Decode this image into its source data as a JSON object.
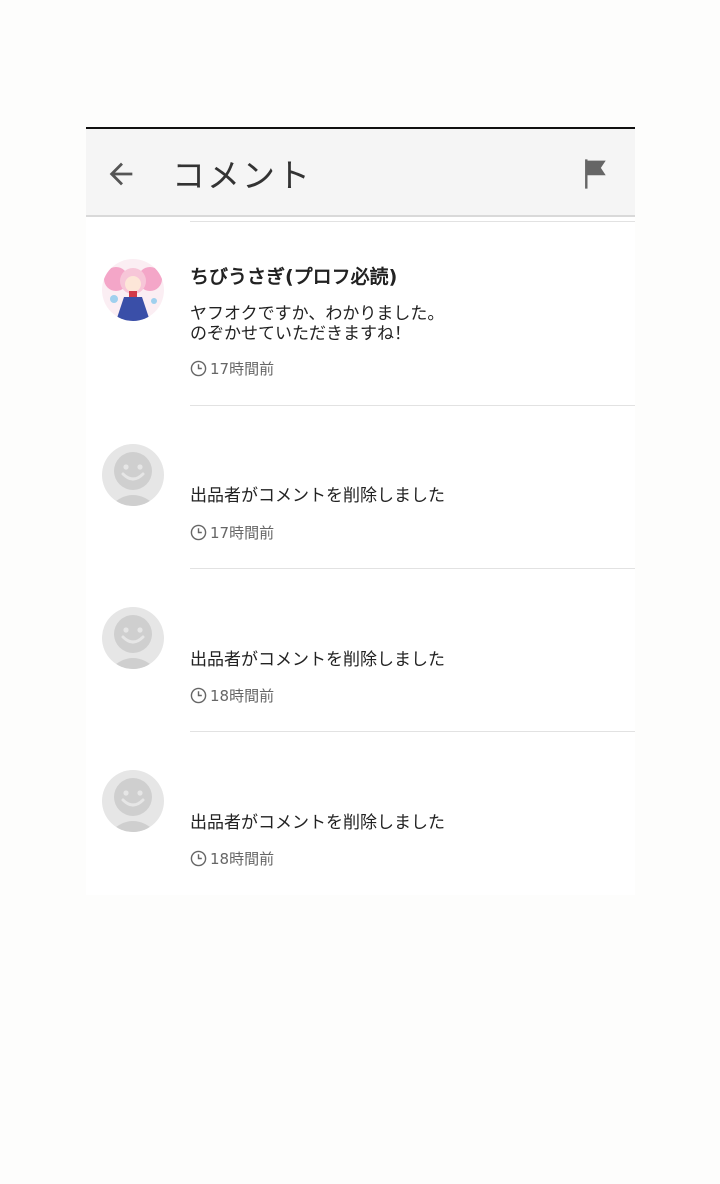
{
  "header": {
    "title": "コメント",
    "back_icon": "arrow-left-icon",
    "report_icon": "flag-icon"
  },
  "comments": [
    {
      "name": "ちびうさぎ(プロフ必読)",
      "text": "ヤフオクですか、わかりました。\nのぞかせていただきますね！",
      "time": "17時間前",
      "avatar": "user-photo"
    },
    {
      "name": "",
      "text": "出品者がコメントを削除しました",
      "time": "17時間前",
      "avatar": "default-avatar-icon"
    },
    {
      "name": "",
      "text": "出品者がコメントを削除しました",
      "time": "18時間前",
      "avatar": "default-avatar-icon"
    },
    {
      "name": "",
      "text": "出品者がコメントを削除しました",
      "time": "18時間前",
      "avatar": "default-avatar-icon"
    }
  ],
  "colors": {
    "header_bg": "#f5f5f5",
    "text": "#222222",
    "meta": "#666666",
    "divider": "#e2e2e2"
  }
}
